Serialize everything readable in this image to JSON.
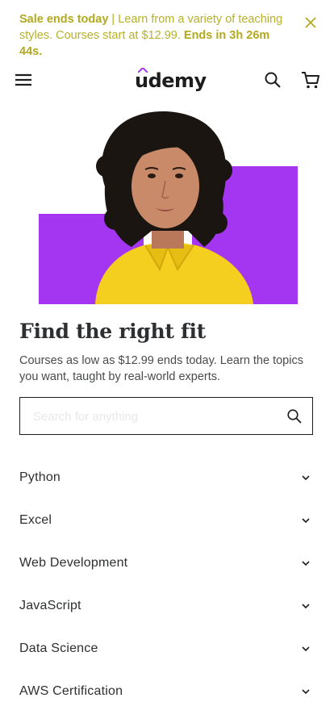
{
  "banner": {
    "bold_lead": "Sale ends today",
    "message": " | Learn from a variety of teaching styles. Courses start at $12.99. ",
    "countdown": "Ends in 3h 26m 44s.",
    "close_icon": "close-icon"
  },
  "header": {
    "logo": "udemy",
    "menu_icon": "hamburger-icon",
    "search_icon": "search-icon",
    "cart_icon": "cart-icon"
  },
  "hero": {
    "image": "woman-portrait",
    "accent_color": "#a435f0",
    "headline": "Find the right fit",
    "subtext": "Courses as low as $12.99 ends today. Learn the topics you want, taught by real-world experts."
  },
  "search": {
    "placeholder": "Search for anything",
    "value": ""
  },
  "topics": [
    {
      "label": "Python"
    },
    {
      "label": "Excel"
    },
    {
      "label": "Web Development"
    },
    {
      "label": "JavaScript"
    },
    {
      "label": "Data Science"
    },
    {
      "label": "AWS Certification"
    }
  ],
  "colors": {
    "banner_text": "#b7b12a",
    "brand_purple": "#a435f0",
    "text_dark": "#1c1d1f"
  }
}
